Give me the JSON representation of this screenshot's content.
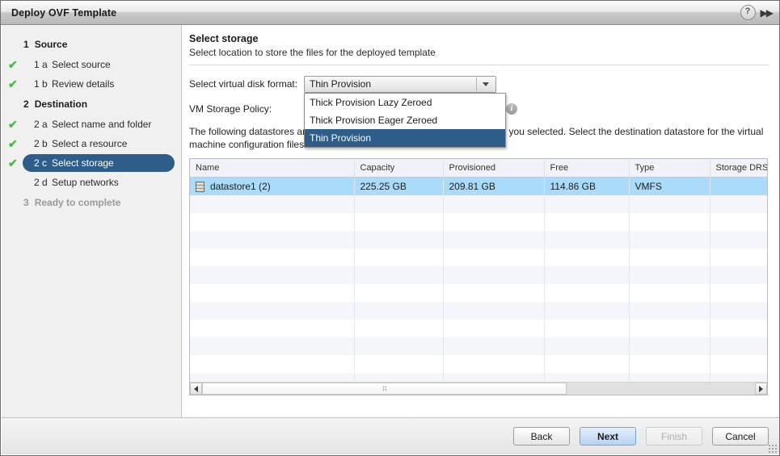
{
  "window": {
    "title": "Deploy OVF Template",
    "help_label": "?",
    "forward_label": "▶▶"
  },
  "sidebar": {
    "groups": [
      {
        "num": "1",
        "label": "Source",
        "muted": false,
        "items": [
          {
            "num": "1 a",
            "label": "Select source",
            "checked": true,
            "selected": false
          },
          {
            "num": "1 b",
            "label": "Review details",
            "checked": true,
            "selected": false
          }
        ]
      },
      {
        "num": "2",
        "label": "Destination",
        "muted": false,
        "items": [
          {
            "num": "2 a",
            "label": "Select name and folder",
            "checked": true,
            "selected": false
          },
          {
            "num": "2 b",
            "label": "Select a resource",
            "checked": true,
            "selected": false
          },
          {
            "num": "2 c",
            "label": "Select storage",
            "checked": true,
            "selected": true
          },
          {
            "num": "2 d",
            "label": "Setup networks",
            "checked": false,
            "selected": false
          }
        ]
      },
      {
        "num": "3",
        "label": "Ready to complete",
        "muted": true,
        "items": []
      }
    ],
    "check_glyph": "✔"
  },
  "main": {
    "title": "Select storage",
    "subtitle": "Select location to store the files for the deployed template",
    "disk_format_label": "Select virtual disk format:",
    "storage_policy_label": "VM Storage Policy:",
    "description": "The following datastores are accessible from the destination resource that you selected. Select the destination datastore for the virtual machine configuration files and all of the virtual disks.",
    "info_glyph": "i"
  },
  "disk_format_combo": {
    "value": "Thin Provision",
    "expanded": true,
    "options": [
      {
        "label": "Thick Provision Lazy Zeroed",
        "selected": false
      },
      {
        "label": "Thick Provision Eager Zeroed",
        "selected": false
      },
      {
        "label": "Thin Provision",
        "selected": true
      }
    ]
  },
  "table": {
    "columns": [
      "Name",
      "Capacity",
      "Provisioned",
      "Free",
      "Type",
      "Storage DRS"
    ],
    "rows": [
      {
        "name": "datastore1 (2)",
        "capacity": "225.25 GB",
        "provisioned": "209.81 GB",
        "free": "114.86 GB",
        "type": "VMFS",
        "storage_drs": "",
        "selected": true
      }
    ],
    "empty_row_count": 11
  },
  "footer": {
    "buttons": [
      {
        "label": "Back",
        "style": "normal",
        "enabled": true
      },
      {
        "label": "Next",
        "style": "primary",
        "enabled": true
      },
      {
        "label": "Finish",
        "style": "disabled",
        "enabled": false
      },
      {
        "label": "Cancel",
        "style": "normal",
        "enabled": true
      }
    ]
  }
}
